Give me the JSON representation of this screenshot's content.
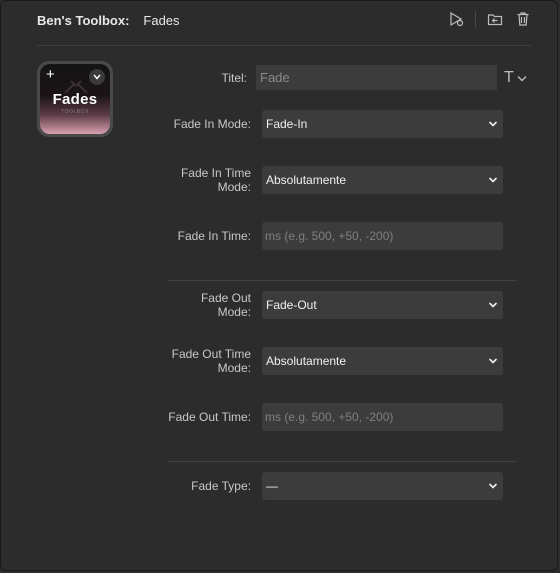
{
  "header": {
    "title": "Ben's Toolbox:",
    "action": "Fades",
    "tools": [
      "test-run-icon",
      "duplicate-icon",
      "trash-icon"
    ]
  },
  "tile": {
    "label": "Fades",
    "sublabel": "TOOLBOX",
    "plus": "+",
    "gradient_colors": [
      "#141414",
      "#5a3a44",
      "#d9a0b0"
    ]
  },
  "title_field": {
    "label": "Titel:",
    "value": "Fade",
    "format_glyph": "T"
  },
  "fade_in": {
    "mode_label": "Fade In Mode:",
    "mode_value": "Fade-In",
    "time_mode_label_1": "Fade In Time",
    "time_mode_label_2": "Mode:",
    "time_mode_value": "Absolutamente",
    "time_label": "Fade In Time:",
    "time_placeholder": "ms (e.g. 500, +50, -200)"
  },
  "fade_out": {
    "mode_label_1": "Fade Out",
    "mode_label_2": "Mode:",
    "mode_value": "Fade-Out",
    "time_mode_label_1": "Fade Out Time",
    "time_mode_label_2": "Mode:",
    "time_mode_value": "Absolutamente",
    "time_label": "Fade Out Time:",
    "time_placeholder": "ms (e.g. 500, +50, -200)"
  },
  "fade_type": {
    "label": "Fade Type:",
    "value": "—"
  },
  "colors": {
    "background": "#2c2c2c",
    "field": "#3c3c3c",
    "text": "#e6e6e6"
  }
}
